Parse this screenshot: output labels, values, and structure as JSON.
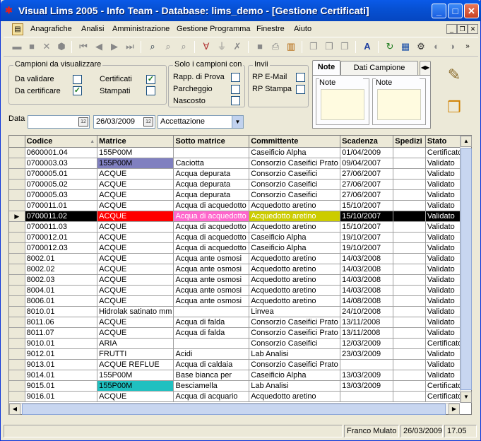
{
  "window": {
    "title": "Visual Lims 2005 - Info Team - Database: lims_demo - [Gestione Certificati]"
  },
  "menu": [
    "Anagrafiche",
    "Analisi",
    "Amministrazione",
    "Gestione Programma",
    "Finestre",
    "Aiuto"
  ],
  "campioni": {
    "legend": "Campioni da visualizzare",
    "da_validare": {
      "label": "Da validare",
      "checked": false
    },
    "da_certificare": {
      "label": "Da certificare",
      "checked": true
    },
    "certificati": {
      "label": "Certificati",
      "checked": true
    },
    "stampati": {
      "label": "Stampati",
      "checked": false
    }
  },
  "solo": {
    "legend": "Solo i campioni con",
    "rapp_prova": {
      "label": "Rapp. di Prova",
      "checked": false
    },
    "parcheggio": {
      "label": "Parcheggio",
      "checked": false
    },
    "nascosto": {
      "label": "Nascosto",
      "checked": false
    }
  },
  "invii": {
    "legend": "Invii",
    "rp_email": {
      "label": "RP E-Mail",
      "checked": false
    },
    "rp_stampa": {
      "label": "RP Stampa",
      "checked": false
    }
  },
  "tabs": {
    "note": "Note",
    "dati_campione": "Dati Campione"
  },
  "notes": {
    "campione": "Note campione",
    "segreteria": "Note segreteria"
  },
  "filter": {
    "data_label": "Data",
    "data_from": "",
    "data_to": "26/03/2009",
    "mode": "Accettazione"
  },
  "grid": {
    "columns": [
      "Codice",
      "Matrice",
      "Sotto matrice",
      "Committente",
      "Scadenza",
      "Spedizi",
      "Stato"
    ],
    "rows": [
      [
        "0600001.04",
        "155P00M",
        "",
        "Caseificio Alpha",
        "01/04/2009",
        "",
        "Certificato"
      ],
      [
        "0700003.03",
        "155P00M",
        "Caciotta",
        "Consorzio Caseifici Prato",
        "09/04/2007",
        "",
        "Validato"
      ],
      [
        "0700005.01",
        "ACQUE",
        "Acqua depurata",
        "Consorzio Caseifici",
        "27/06/2007",
        "",
        "Validato"
      ],
      [
        "0700005.02",
        "ACQUE",
        "Acqua depurata",
        "Consorzio Caseifici",
        "27/06/2007",
        "",
        "Validato"
      ],
      [
        "0700005.03",
        "ACQUE",
        "Acqua depurata",
        "Consorzio Caseifici",
        "27/06/2007",
        "",
        "Validato"
      ],
      [
        "0700011.01",
        "ACQUE",
        "Acqua di acquedotto",
        "Acquedotto aretino",
        "15/10/2007",
        "",
        "Validato"
      ],
      [
        "0700011.02",
        "ACQUE",
        "Acqua di acquedotto",
        "Acquedotto aretino",
        "15/10/2007",
        "",
        "Validato"
      ],
      [
        "0700011.03",
        "ACQUE",
        "Acqua di acquedotto",
        "Acquedotto aretino",
        "15/10/2007",
        "",
        "Validato"
      ],
      [
        "0700012.01",
        "ACQUE",
        "Acqua di acquedotto",
        "Caseificio Alpha",
        "19/10/2007",
        "",
        "Validato"
      ],
      [
        "0700012.03",
        "ACQUE",
        "Acqua di acquedotto",
        "Caseificio Alpha",
        "19/10/2007",
        "",
        "Validato"
      ],
      [
        "8002.01",
        "ACQUE",
        "Acqua ante osmosi",
        "Acquedotto aretino",
        "14/03/2008",
        "",
        "Validato"
      ],
      [
        "8002.02",
        "ACQUE",
        "Acqua ante osmosi",
        "Acquedotto aretino",
        "14/03/2008",
        "",
        "Validato"
      ],
      [
        "8002.03",
        "ACQUE",
        "Acqua ante osmosi",
        "Acquedotto aretino",
        "14/03/2008",
        "",
        "Validato"
      ],
      [
        "8004.01",
        "ACQUE",
        "Acqua ante osmosi",
        "Acquedotto aretino",
        "14/03/2008",
        "",
        "Validato"
      ],
      [
        "8006.01",
        "ACQUE",
        "Acqua ante osmosi",
        "Acquedotto aretino",
        "14/08/2008",
        "",
        "Validato"
      ],
      [
        "8010.01",
        "Hidrolak satinato mm",
        "",
        "Linvea",
        "24/10/2008",
        "",
        "Validato"
      ],
      [
        "8011.06",
        "ACQUE",
        "Acqua di falda",
        "Consorzio Caseifici Prato",
        "13/11/2008",
        "",
        "Validato"
      ],
      [
        "8011.07",
        "ACQUE",
        "Acqua di falda",
        "Consorzio Caseifici Prato",
        "13/11/2008",
        "",
        "Validato"
      ],
      [
        "9010.01",
        "ARIA",
        "",
        "Consorzio Caseifici",
        "12/03/2009",
        "",
        "Certificato"
      ],
      [
        "9012.01",
        "FRUTTI",
        "Acidi",
        "Lab Analisi",
        "23/03/2009",
        "",
        "Validato"
      ],
      [
        "9013.01",
        "ACQUE REFLUE",
        "Acqua di caldaia",
        "Consorzio Caseifici Prato",
        "",
        "",
        "Validato"
      ],
      [
        "9014.01",
        "155P00M",
        "Base bianca per",
        "Caseificio Alpha",
        "13/03/2009",
        "",
        "Validato"
      ],
      [
        "9015.01",
        "155P00M",
        "Besciamella",
        "Lab Analisi",
        "13/03/2009",
        "",
        "Certificato"
      ],
      [
        "9016.01",
        "ACQUE",
        "Acqua di acquario",
        "Acquedotto aretino",
        "",
        "",
        "Certificato"
      ]
    ],
    "selected_row": 6
  },
  "status": {
    "user": "Franco Mulato",
    "date": "26/03/2009",
    "time": "17.05"
  },
  "colors": {
    "selected_matrice": "#ff0000",
    "selected_sotto": "#ff66cc",
    "selected_committente": "#cccc00",
    "row2_matrice": "#8080c0",
    "row23_matrice": "#20c0c0"
  }
}
